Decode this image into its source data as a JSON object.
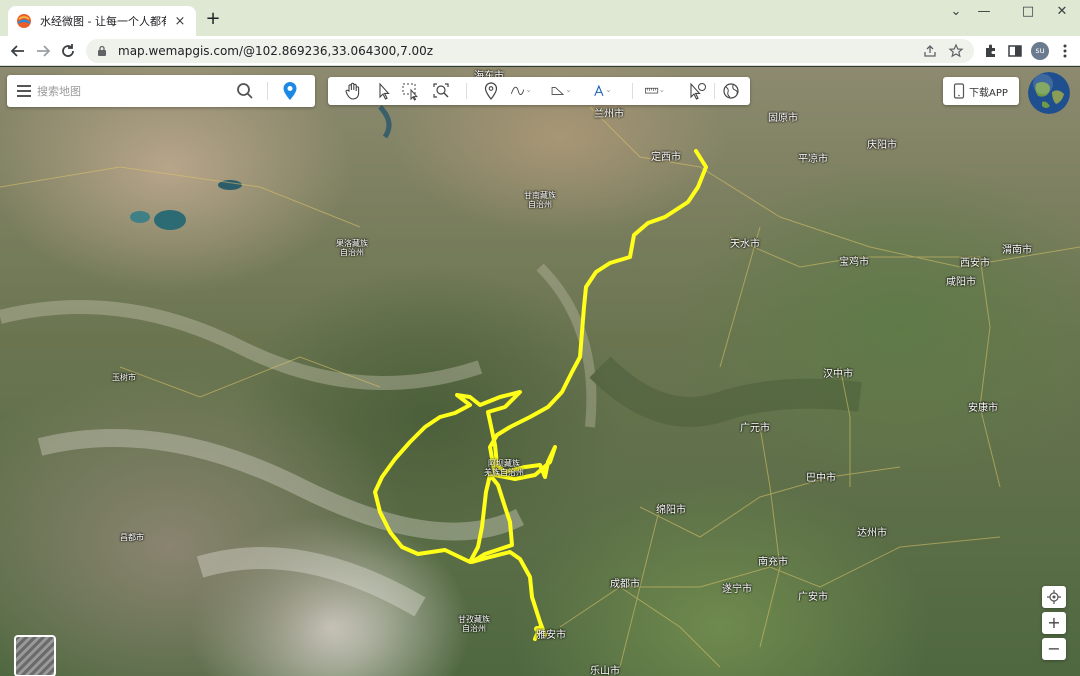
{
  "browser": {
    "tab_title": "水经微图 - 让每一个人都有自己",
    "tab_close": "×",
    "new_tab": "+",
    "window_controls": {
      "minimize": "—",
      "restore": "□",
      "close": "✕",
      "tabs_menu": "⌄"
    },
    "url": "map.wemapgis.com/@102.869236,33.064300,7.00z",
    "profile_initials": "su"
  },
  "search": {
    "placeholder": "搜索地图"
  },
  "tools": [
    "pan-tool",
    "select-tool",
    "box-select-tool",
    "zoom-extent-tool",
    "marker-tool",
    "polyline-tool",
    "polygon-tool",
    "text-tool",
    "measure-tool",
    "identify-tool",
    "world-tool"
  ],
  "download_app_label": "下载APP",
  "zoom": {
    "in": "+",
    "out": "−"
  },
  "cities": {
    "lanzhou": "兰州市",
    "dingxi": "定西市",
    "guyuan": "固原市",
    "qingyang": "庆阳市",
    "pingliang": "平凉市",
    "gannan_a": "甘南藏族",
    "gannan_b": "自治州",
    "tianshui": "天水市",
    "baoji": "宝鸡市",
    "xian": "西安市",
    "weinan": "渭南市",
    "xianyang": "咸阳市",
    "guoluo_a": "果洛藏族",
    "guoluo_b": "自治州",
    "yushu": "玉树市",
    "hanzhong": "汉中市",
    "ankang": "安康市",
    "guangyuan": "广元市",
    "aba_a": "阿坝藏族",
    "aba_b": "羌族自治州",
    "bazhong": "巴中市",
    "mianyang": "绵阳市",
    "dazhou": "达州市",
    "changdu": "昌都市",
    "nanchong": "南充市",
    "chengdu": "成都市",
    "suining": "遂宁市",
    "guangan": "广安市",
    "ganzi_a": "甘孜藏族",
    "ganzi_b": "自治州",
    "yaan": "雅安市",
    "leshan": "乐山市",
    "dunhuang_partial": "海东市"
  }
}
